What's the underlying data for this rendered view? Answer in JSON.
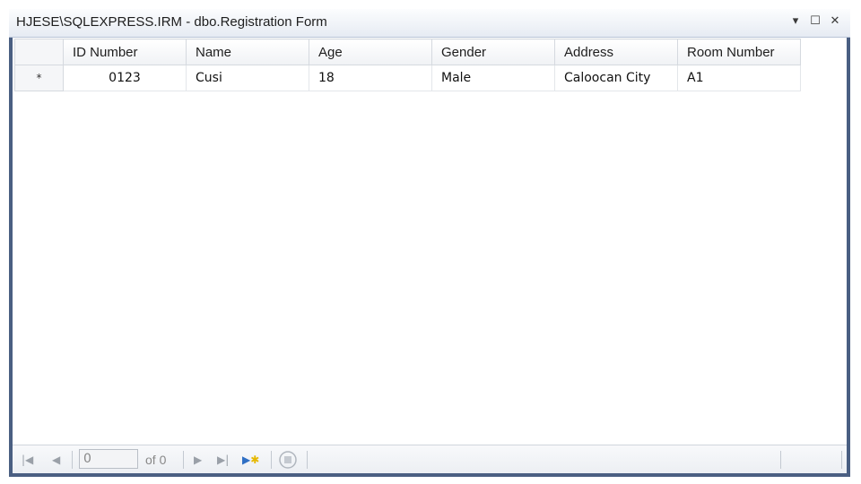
{
  "window": {
    "title": "HJESE\\SQLEXPRESS.IRM - dbo.Registration Form",
    "controls": {
      "dropdown_icon": "dropdown-arrow-icon",
      "maximize_icon": "maximize-icon",
      "close_icon": "close-icon"
    }
  },
  "grid": {
    "columns": [
      "ID Number",
      "Name",
      "Age",
      "Gender",
      "Address",
      "Room Number"
    ],
    "rows": [
      {
        "marker": "*",
        "cells": [
          "0123",
          "Cusi",
          "18",
          "Male",
          "Caloocan City",
          "A1"
        ]
      }
    ]
  },
  "navigator": {
    "position_value": "0",
    "of_label": "of 0",
    "icons": [
      "move-first-icon",
      "move-previous-icon",
      "move-next-icon",
      "move-last-icon",
      "move-new-icon",
      "stop-icon"
    ]
  }
}
